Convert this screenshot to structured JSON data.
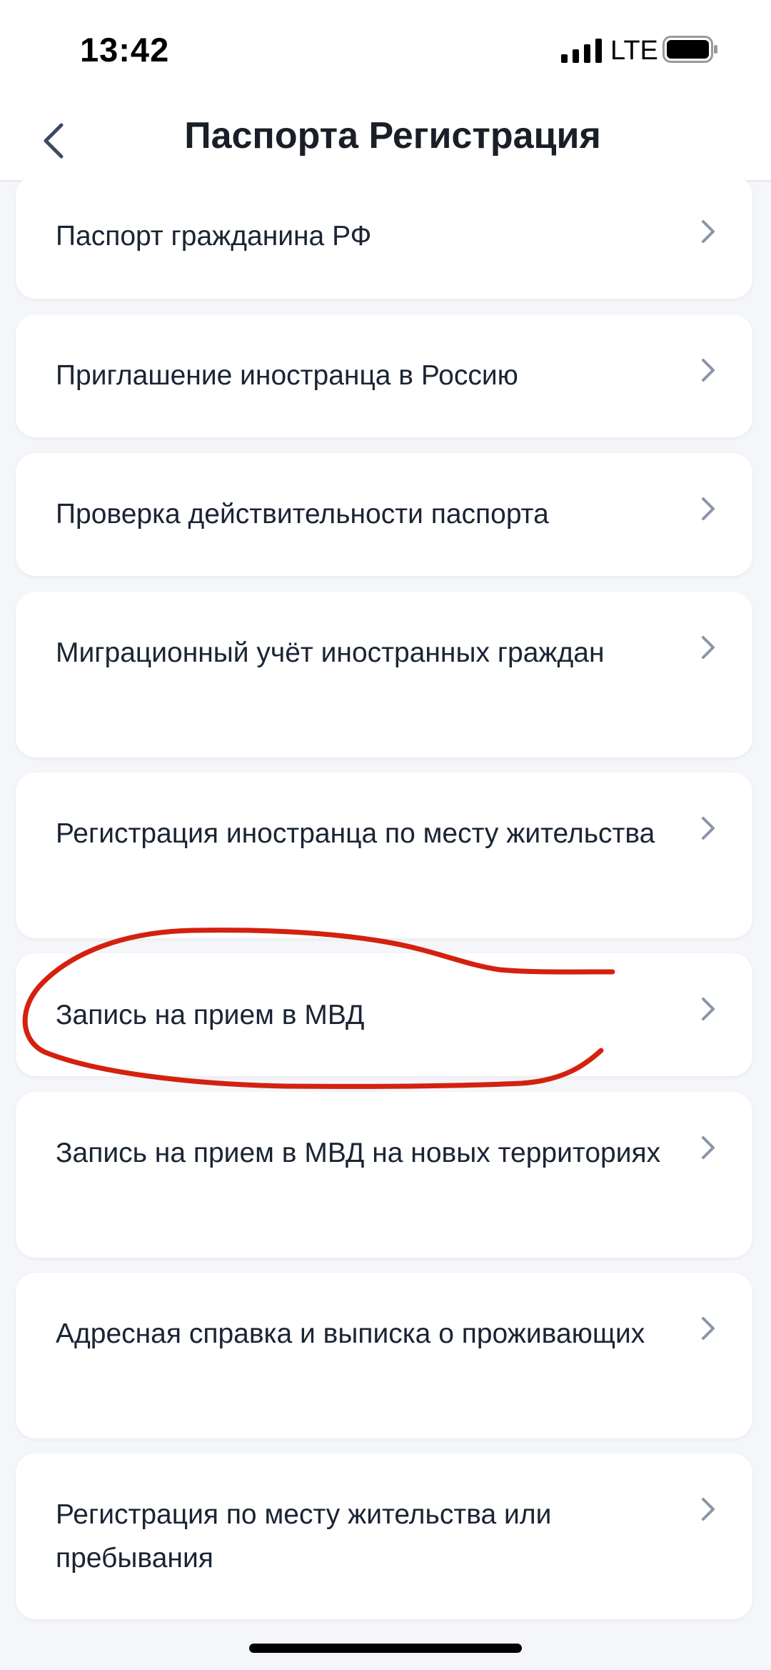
{
  "status_bar": {
    "time": "13:42",
    "network": "LTE",
    "icons": [
      "signal-icon",
      "battery-icon"
    ]
  },
  "header": {
    "title": "Паспорта Регистрация",
    "back_icon": "chevron-left-icon"
  },
  "items": [
    {
      "label": "Паспорт гражданина РФ"
    },
    {
      "label": "Приглашение иностранца в Россию"
    },
    {
      "label": "Проверка действительности паспорта"
    },
    {
      "label": "Миграционный учёт иностранных граждан"
    },
    {
      "label": "Регистрация иностранца по месту жительства"
    },
    {
      "label": "Запись на прием в МВД"
    },
    {
      "label": "Запись на прием в МВД на новых территориях"
    },
    {
      "label": "Адресная справка и выписка о проживающих"
    },
    {
      "label": "Регистрация по месту жительства или пребывания"
    }
  ],
  "colors": {
    "background": "#f4f6fa",
    "card": "#ffffff",
    "text": "#1b2434",
    "chevron": "#8a96a8",
    "annotation": "#d4210f"
  }
}
